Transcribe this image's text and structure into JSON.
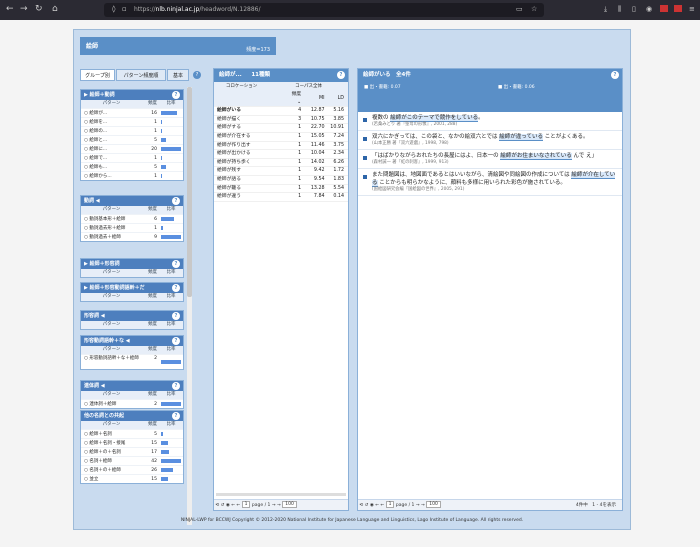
{
  "browser": {
    "url_prefix": "https://",
    "url_domain": "nlb.ninjal.ac.jp",
    "url_path": "/headword/N.12886/",
    "back": "←",
    "forward": "→",
    "reload": "↻",
    "home": "⌂"
  },
  "header": {
    "title": "絵師",
    "freq": "頻度=173"
  },
  "tabs": [
    {
      "label": "グループ別"
    },
    {
      "label": "パターン頻度順"
    },
    {
      "label": "基本"
    }
  ],
  "help": "?",
  "colh": {
    "pattern": "パターン",
    "freq": "頻度",
    "ratio": "比率"
  },
  "groups": [
    {
      "title": "▶ 絵師＋動詞",
      "rows": [
        {
          "p": "絵師が...",
          "f": "16",
          "r": 0.8
        },
        {
          "p": "絵師を...",
          "f": "1",
          "r": 0.05
        },
        {
          "p": "絵師の...",
          "f": "1",
          "r": 0.05
        },
        {
          "p": "絵師と...",
          "f": "5",
          "r": 0.25
        },
        {
          "p": "絵師に...",
          "f": "20",
          "r": 1.0
        },
        {
          "p": "絵師で...",
          "f": "1",
          "r": 0.05
        },
        {
          "p": "絵師も...",
          "f": "5",
          "r": 0.25
        },
        {
          "p": "絵師から...",
          "f": "1",
          "r": 0.05
        }
      ]
    },
    {
      "title": "動詞 ◀",
      "rows": [
        {
          "p": "動詞基本形＋絵師",
          "f": "6",
          "r": 0.66
        },
        {
          "p": "動詞過去形＋絵師",
          "f": "1",
          "r": 0.11
        },
        {
          "p": "動詞過去＋絵師",
          "f": "9",
          "r": 1.0
        }
      ]
    },
    {
      "title": "▶ 絵師＋形容詞",
      "rows": []
    },
    {
      "title": "▶ 絵師＋形容動詞語幹＋だ",
      "rows": []
    },
    {
      "title": "形容詞 ◀",
      "rows": []
    },
    {
      "title": "形容動詞語幹＋な ◀",
      "rows": [
        {
          "p": "形容動詞語幹＋な＋絵師",
          "f": "2",
          "r": 1.0
        }
      ]
    },
    {
      "title": "連体詞 ◀",
      "rows": [
        {
          "p": "連体詞＋絵師",
          "f": "2",
          "r": 1.0
        }
      ]
    },
    {
      "title": "他の名詞との共起",
      "rows": [
        {
          "p": "絵師＋名詞",
          "f": "5",
          "r": 0.12
        },
        {
          "p": "絵師＋名詞・接尾",
          "f": "15",
          "r": 0.36
        },
        {
          "p": "絵師＋の＋名詞",
          "f": "17",
          "r": 0.4
        },
        {
          "p": "名詞＋絵師",
          "f": "42",
          "r": 1.0
        },
        {
          "p": "名詞＋の＋絵師",
          "f": "26",
          "r": 0.62
        },
        {
          "p": "並立",
          "f": "15",
          "r": 0.36
        }
      ]
    }
  ],
  "mid": {
    "title": "絵師が...",
    "count": "11種類",
    "tab1": "コロケーション",
    "tab2": "コーパス全体",
    "h_freq": "頻度 ⌄",
    "h_mi": "MI",
    "h_ld": "LD",
    "rows": [
      [
        "絵師がいる",
        "4",
        "12.87",
        "5.16"
      ],
      [
        "絵師が描く",
        "3",
        "10.75",
        "3.85"
      ],
      [
        "絵師がする",
        "1",
        "22.70",
        "10.91"
      ],
      [
        "絵師が介在する",
        "1",
        "15.05",
        "7.24"
      ],
      [
        "絵師が作り出す",
        "1",
        "11.46",
        "3.75"
      ],
      [
        "絵師が出かける",
        "1",
        "10.04",
        "2.34"
      ],
      [
        "絵師が持ち歩く",
        "1",
        "14.02",
        "6.26"
      ],
      [
        "絵師が残す",
        "1",
        "9.42",
        "1.72"
      ],
      [
        "絵師が語る",
        "1",
        "9.54",
        "1.83"
      ],
      [
        "絵師が籠る",
        "1",
        "13.28",
        "5.54"
      ],
      [
        "絵師が違う",
        "1",
        "7.84",
        "0.14"
      ]
    ],
    "pager": {
      "icons": "⟲ ↺ ◉ ← ←",
      "page": "1",
      "of": "page / 1",
      "nav": "→ →",
      "size": "100"
    }
  },
  "right": {
    "title": "絵師がいる　全4件",
    "l1": "■ 出・書籍: 0.07",
    "l2": "■ 出・書籍: 0.06",
    "sentences": [
      {
        "pre": "複数の ",
        "hl": "絵師がこのテーマで競作をしている",
        "post": "。",
        "src": "(若桑みどり 著『聖母の形像』, 2001, 288)"
      },
      {
        "pre": "双六にかぎっては、この袋と、なかの絵双六とでは ",
        "hl": "絵師が違っている",
        "post": " ことがよくある。",
        "src": "(山本正勝 著『双六遊戯』, 1998, 798)"
      },
      {
        "pre": "「はばかりながらおれたちの長屋にはよ、日本一の ",
        "hl": "絵師がお住まいなされている",
        "post": " んで え」",
        "src": "(森村誠一 著『虹の刺客』, 1999, 913)"
      },
      {
        "pre": "また問題図は、地図面であるとはいいながら、清絵図や同絵図の作成については ",
        "hl": "絵師が介在している",
        "post": " ことからも明らかなように、顔料も多様に用いられた彩色が施されている。",
        "src": "(国絵図研究会編『国絵図の世界』, 2005, 291)"
      }
    ],
    "pager": {
      "icons": "⟲ ↺ ◉ ← ←",
      "page": "1",
      "of": "page / 1",
      "nav": "→ →",
      "size": "100",
      "count": "4件中　1 - 4を表示"
    }
  },
  "footer": "NINJAL-LWP for BCCWJ Copyright © 2012-2020 National Institute for Japanese Language and Linguistics, Lago Institute of Language. All rights reserved."
}
